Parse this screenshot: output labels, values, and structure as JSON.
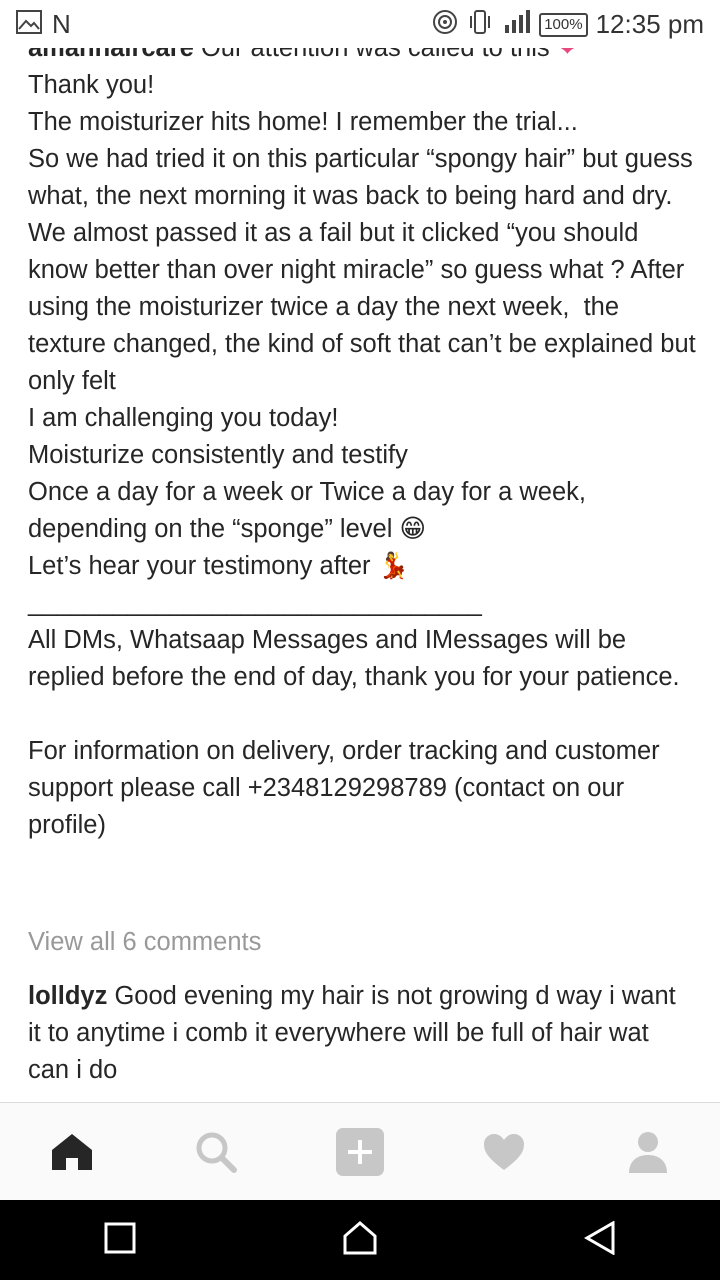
{
  "status_bar": {
    "left_letter": "N",
    "battery": "100%",
    "time": "12:35 pm"
  },
  "post": {
    "username": "amannaircare",
    "caption_lines": [
      "Our attention was called to this",
      "Thank you!",
      "The moisturizer hits home! I remember the trial...",
      "So we had tried it on this particular “spongy hair” but guess what, the next morning it was back to being hard and dry.",
      "We almost passed it as a fail but it clicked “you should know better than over night miracle” so guess what ? After using the moisturizer twice a day the next week,  the texture changed, the kind of soft that can’t be explained but only felt",
      "I am challenging you today!",
      "Moisturize consistently and testify",
      "Once a day for a week or Twice a day for a week, depending on the “sponge” level 😁",
      "Let’s hear your testimony after 💃",
      "________________________________",
      "All DMs, Whatsaap Messages and IMessages will be replied before the end of day, thank you for your patience.",
      "",
      "For information on delivery, order tracking and customer support please call +2348129298789 (contact on our profile)"
    ],
    "view_all": "View all 6 comments"
  },
  "comment": {
    "username": "lolldyz",
    "text": "Good evening my hair is not growing d way i want it to anytime i comb it everywhere will be full of hair wat can i do"
  },
  "nav": {
    "items": [
      "home-icon",
      "search-icon",
      "add-icon",
      "heart-icon",
      "profile-icon"
    ]
  },
  "colors": {
    "text": "#262626",
    "muted": "#999999",
    "nav_icon": "#c7c7c7",
    "heart_emoji": "#e84a7f"
  }
}
